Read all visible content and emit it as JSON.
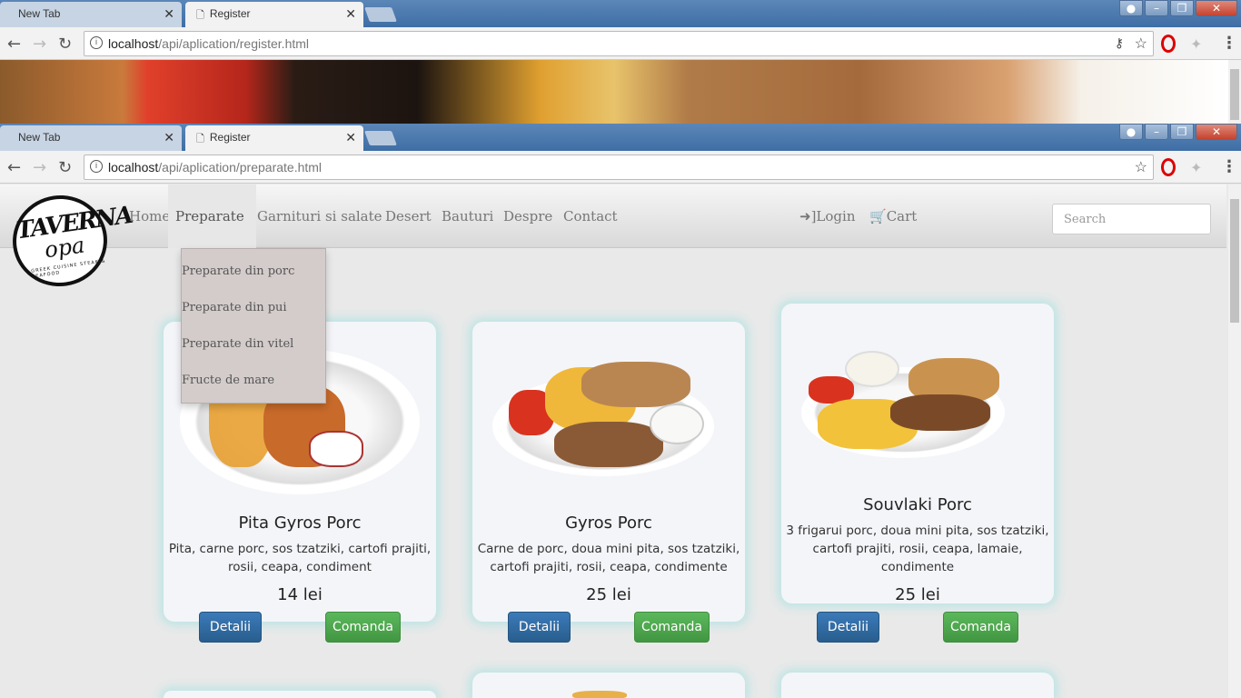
{
  "browser_back": {
    "tabs": [
      {
        "label": "New Tab"
      },
      {
        "label": "Register"
      }
    ],
    "url_host": "localhost",
    "url_path": "/api/aplication/register.html"
  },
  "browser_front": {
    "tabs": [
      {
        "label": "New Tab"
      },
      {
        "label": "Register"
      }
    ],
    "url_host": "localhost",
    "url_path": "/api/aplication/preparate.html"
  },
  "logo": {
    "line1": "TAVERNA",
    "line2": "opa",
    "line3": "GREEK CUISINE STEAK & SEAFOOD"
  },
  "nav": {
    "items": [
      "Home",
      "Preparate",
      "Garnituri si salate",
      "Desert",
      "Bauturi",
      "Despre",
      "Contact"
    ],
    "active": "Preparate",
    "login": "Login",
    "cart": "Cart",
    "search_placeholder": "Search"
  },
  "dropdown": [
    "Preparate din porc",
    "Preparate din pui",
    "Preparate din vitel",
    "Fructe de mare"
  ],
  "products": [
    {
      "title": "Pita Gyros Porc",
      "desc": "Pita, carne porc, sos tzatziki, cartofi prajiti, rosii, ceapa, condiment",
      "price": "14 lei",
      "details": "Detalii",
      "order": "Comanda"
    },
    {
      "title": "Gyros Porc",
      "desc": "Carne de porc, doua mini pita, sos tzatziki, cartofi prajiti, rosii, ceapa, condimente",
      "price": "25 lei",
      "details": "Detalii",
      "order": "Comanda"
    },
    {
      "title": "Souvlaki Porc",
      "desc": "3 frigarui porc, doua mini pita, sos tzatziki, cartofi prajiti, rosii, ceapa, lamaie, condimente",
      "price": "25 lei",
      "details": "Detalii",
      "order": "Comanda"
    }
  ],
  "colors": {
    "primary_btn": "#337ab7",
    "success_btn": "#5cb85c",
    "card_glow": "#a0e1e1",
    "dropdown_bg": "#d3cccb"
  }
}
